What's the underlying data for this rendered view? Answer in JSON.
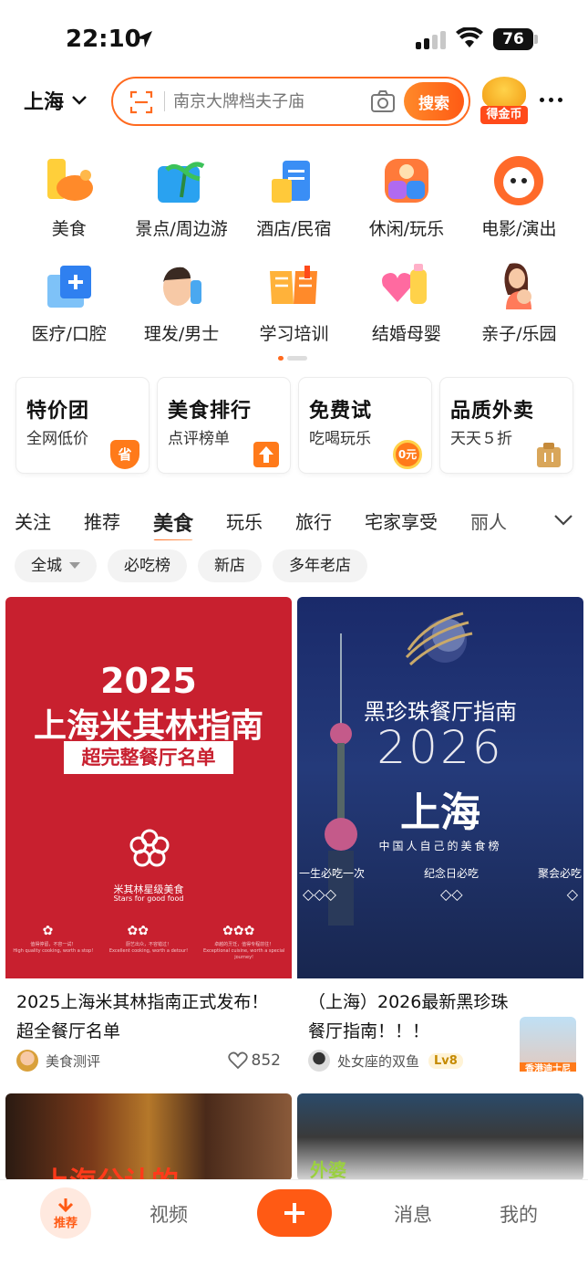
{
  "status": {
    "time": "22:10",
    "battery": "76"
  },
  "header": {
    "city": "上海",
    "search_placeholder": "南京大牌档夫子庙",
    "search_button": "搜索",
    "coin_label": "得金币"
  },
  "categories": [
    {
      "label": "美食",
      "icon": "food-icon"
    },
    {
      "label": "景点/周边游",
      "icon": "scenic-icon"
    },
    {
      "label": "酒店/民宿",
      "icon": "hotel-icon"
    },
    {
      "label": "休闲/玩乐",
      "icon": "leisure-icon"
    },
    {
      "label": "电影/演出",
      "icon": "movie-icon"
    },
    {
      "label": "医疗/口腔",
      "icon": "medical-icon"
    },
    {
      "label": "理发/男士",
      "icon": "barber-icon"
    },
    {
      "label": "学习培训",
      "icon": "study-icon"
    },
    {
      "label": "结婚母婴",
      "icon": "wedding-baby-icon"
    },
    {
      "label": "亲子/乐园",
      "icon": "family-icon"
    }
  ],
  "promos": [
    {
      "title": "特价团",
      "subtitle": "全网低价",
      "badge": "省"
    },
    {
      "title": "美食排行",
      "subtitle": "点评榜单",
      "badge": ""
    },
    {
      "title": "免费试",
      "subtitle": "吃喝玩乐",
      "badge": "0元"
    },
    {
      "title": "品质外卖",
      "subtitle": "天天５折",
      "badge": ""
    }
  ],
  "tabs": [
    "关注",
    "推荐",
    "美食",
    "玩乐",
    "旅行",
    "宅家享受",
    "丽人"
  ],
  "active_tab": "美食",
  "chips": [
    "全城",
    "必吃榜",
    "新店",
    "多年老店"
  ],
  "feed": [
    {
      "image_text": {
        "year": "2025",
        "headline": "上海米其林指南",
        "banner": "超完整餐厅名单",
        "logo_cn": "米其林星级美食",
        "logo_en": "Stars for good food",
        "star_captions": [
          "值得停留，不容一试！",
          "厨艺出众，不容错过！",
          "卓越的烹饪，值得专程前往！"
        ],
        "star_captions_en": [
          "High quality cooking, worth a stop!",
          "Excellent cooking, worth a detour!",
          "Exceptional cuisine, worth a special journey!"
        ]
      },
      "title": "2025上海米其林指南正式发布！超全餐厅名单",
      "author": "美食测评",
      "likes": "852"
    },
    {
      "image_text": {
        "brand": "黑珍珠餐厅指南",
        "year": "2026",
        "city": "上海",
        "tagline": "中国人自己的美食榜",
        "levels": [
          "一生必吃一次",
          "纪念日必吃",
          "聚会必吃"
        ]
      },
      "title": "（上海）2026最新黑珍珠餐厅指南！！！",
      "author": "处女座的双鱼",
      "level": "Lv8",
      "thumb_label": "香港迪士尼"
    },
    {
      "image_text": {
        "partial": "上海公认的"
      }
    },
    {
      "image_text": {
        "partial": "外婆"
      }
    }
  ],
  "bottom_nav": {
    "home": "推荐",
    "video": "视频",
    "messages": "消息",
    "mine": "我的"
  },
  "colors": {
    "accent": "#ff5a14",
    "michelin_red": "#c8202f",
    "pearl_navy": "#1a2a6a"
  }
}
